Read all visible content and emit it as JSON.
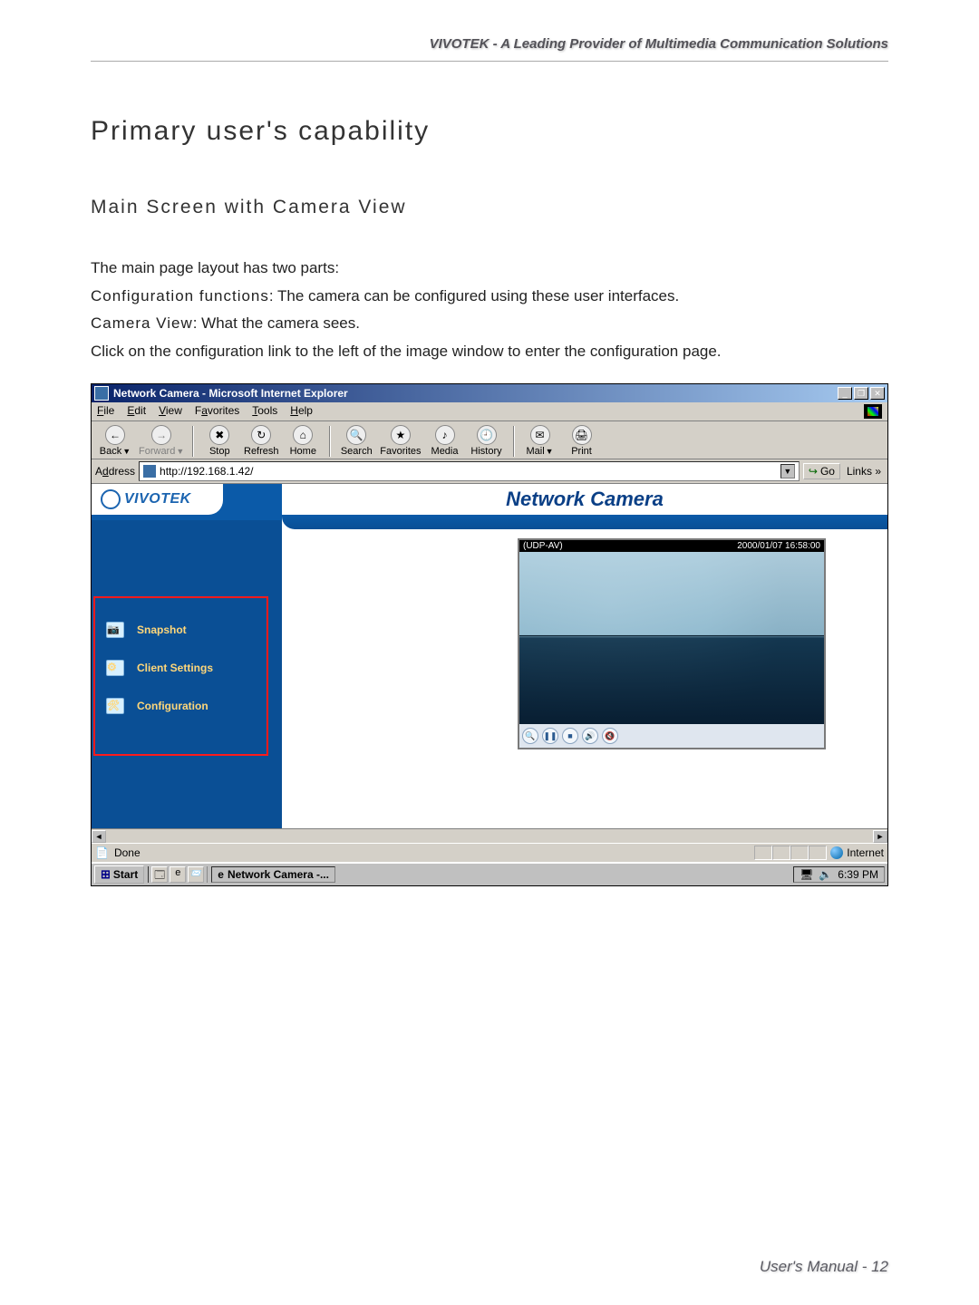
{
  "header": "VIVOTEK - A Leading Provider of Multimedia Communication Solutions",
  "h1": "Primary user's capability",
  "h2": "Main Screen with Camera View",
  "para_intro": "The main page layout has two parts:",
  "cfg_label": "Configuration functions",
  "cfg_text": ": The camera can be configured using these user interfaces.",
  "cam_label": "Camera View",
  "cam_text": ": What the camera sees.",
  "para_click": "Click on the configuration link to the left of the image window to enter the configuration page.",
  "ie": {
    "title": "Network Camera - Microsoft Internet Explorer",
    "menus": {
      "file": "File",
      "edit": "Edit",
      "view": "View",
      "fav": "Favorites",
      "tools": "Tools",
      "help": "Help"
    },
    "tools": {
      "back": "Back",
      "forward": "Forward",
      "stop": "Stop",
      "refresh": "Refresh",
      "home": "Home",
      "search": "Search",
      "favorites": "Favorites",
      "media": "Media",
      "history": "History",
      "mail": "Mail",
      "print": "Print"
    },
    "address_label": "Address",
    "url": "http://192.168.1.42/",
    "go": "Go",
    "links": "Links »",
    "status": "Done",
    "zone": "Internet"
  },
  "webapp": {
    "brand": "VIVOTEK",
    "title": "Network Camera",
    "sidebar": {
      "snapshot": "Snapshot",
      "client": "Client Settings",
      "config": "Configuration"
    },
    "overlay_left": "(UDP-AV)",
    "overlay_right": "2000/01/07 16:58:00"
  },
  "taskbar": {
    "start": "Start",
    "task": "Network Camera -...",
    "clock": "6:39 PM"
  },
  "footer": "User's Manual - 12"
}
